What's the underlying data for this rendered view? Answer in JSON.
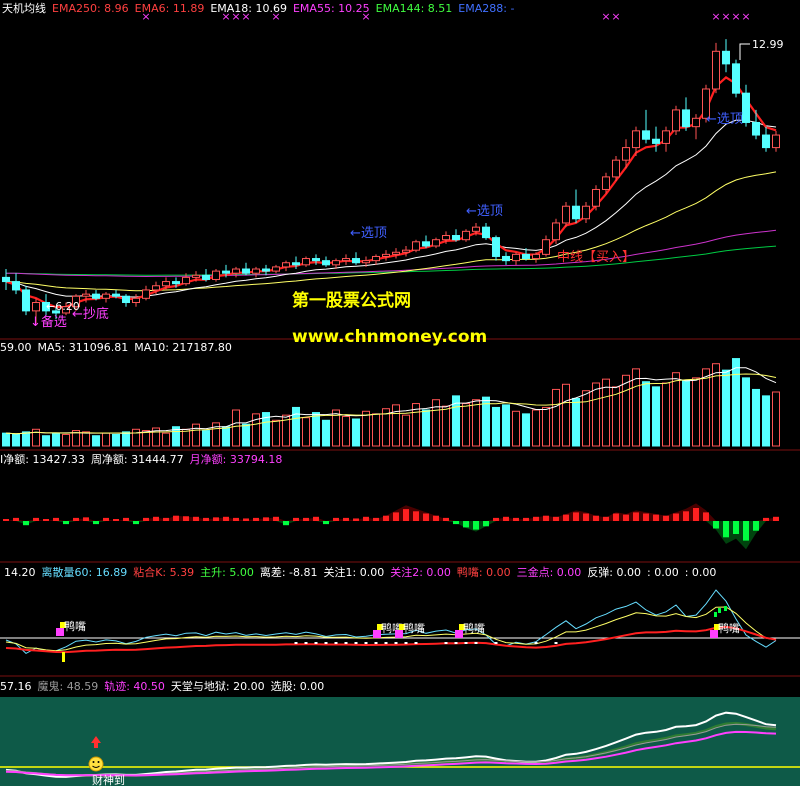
{
  "colors": {
    "up": "#ff5555",
    "down": "#55ffff",
    "divider": "#7a1010",
    "ema6": "#ff2020",
    "ema18": "#ffffff",
    "ema55": "#ffff66",
    "ema144": "#00cc44",
    "ema250": "#cc33cc",
    "ema288": "#3a6ad0",
    "magenta": "#ff40ff",
    "green": "#00ff40",
    "yellow": "#ffff00",
    "panel5bg": "#0e5a48",
    "panel5line": "#ffff00",
    "cyanline": "#66ddff"
  },
  "panel1": {
    "legend": [
      {
        "text": "天机均线",
        "color": "#ffffff"
      },
      {
        "text": "EMA250: 8.96",
        "color": "#ff4040"
      },
      {
        "text": "EMA6: 11.89",
        "color": "#ff4040"
      },
      {
        "text": "EMA18: 10.69",
        "color": "#ffffff"
      },
      {
        "text": "EMA55: 10.25",
        "color": "#ff40ff"
      },
      {
        "text": "EMA144: 8.51",
        "color": "#40ff40"
      },
      {
        "text": "EMA288: -",
        "color": "#4070ff"
      }
    ],
    "annotations": {
      "high": "12.99",
      "low": "←6.20",
      "select_top1": "←选顶",
      "select_top2": "←选顶",
      "select_top3": "←选顶",
      "middle_buy": "中线【买入】",
      "stock_line": "↓备选",
      "bottom_fish": "←抄底"
    },
    "markers": "×",
    "watermark": {
      "title": "第一股票公式网",
      "url": "www.chnmoney.com"
    }
  },
  "panel2": {
    "legend": [
      {
        "text": "59.00",
        "color": "#ffffff"
      },
      {
        "text": "MA5: 311096.81",
        "color": "#ffffff"
      },
      {
        "text": "MA10: 217187.80",
        "color": "#ffffff"
      }
    ]
  },
  "panel3": {
    "legend": [
      {
        "text": "I净额: 13427.33",
        "color": "#ffffff"
      },
      {
        "text": "周净额: 31444.77",
        "color": "#ffffff"
      },
      {
        "text": "月净额: 33794.18",
        "color": "#ff40ff"
      }
    ]
  },
  "panel4": {
    "legend": [
      {
        "text": "14.20",
        "color": "#ffffff"
      },
      {
        "text": "离散量60: 16.89",
        "color": "#66ddff"
      },
      {
        "text": "粘合K: 5.39",
        "color": "#ff4040"
      },
      {
        "text": "主升: 5.00",
        "color": "#40ff40"
      },
      {
        "text": "离差: -8.81",
        "color": "#ffffff"
      },
      {
        "text": "关注1: 0.00",
        "color": "#ffffff"
      },
      {
        "text": "关注2: 0.00",
        "color": "#ff40ff"
      },
      {
        "text": "鸭嘴: 0.00",
        "color": "#ff4040"
      },
      {
        "text": "三金点: 0.00",
        "color": "#ff40ff"
      },
      {
        "text": "反弹: 0.00",
        "color": "#ffffff"
      },
      {
        "text": ": 0.00",
        "color": "#ffffff"
      },
      {
        "text": ": 0.00",
        "color": "#ffffff"
      }
    ],
    "duckbill": "鸭嘴"
  },
  "panel5": {
    "legend": [
      {
        "text": "57.16",
        "color": "#ffffff"
      },
      {
        "text": "魔鬼: 48.59",
        "color": "#999999"
      },
      {
        "text": "轨迹: 40.50",
        "color": "#ff40ff"
      },
      {
        "text": "天堂与地狱: 20.00",
        "color": "#ffffff"
      },
      {
        "text": "选股: 0.00",
        "color": "#ffffff"
      }
    ],
    "fortune": "财神到"
  },
  "chart_data": {
    "type": "candlestick",
    "price_range": [
      5.9,
      13.4
    ],
    "candles": [
      [
        7.3,
        7.5,
        7.0,
        7.2
      ],
      [
        7.2,
        7.4,
        6.9,
        7.0
      ],
      [
        7.0,
        7.1,
        6.4,
        6.5
      ],
      [
        6.5,
        6.8,
        6.2,
        6.7
      ],
      [
        6.7,
        6.9,
        6.4,
        6.5
      ],
      [
        6.5,
        6.6,
        6.3,
        6.45
      ],
      [
        6.45,
        6.7,
        6.4,
        6.6
      ],
      [
        6.6,
        6.9,
        6.5,
        6.85
      ],
      [
        6.85,
        7.0,
        6.7,
        6.9
      ],
      [
        6.9,
        7.0,
        6.75,
        6.8
      ],
      [
        6.8,
        6.95,
        6.7,
        6.9
      ],
      [
        6.9,
        7.0,
        6.8,
        6.85
      ],
      [
        6.85,
        6.9,
        6.6,
        6.7
      ],
      [
        6.7,
        6.9,
        6.6,
        6.8
      ],
      [
        6.8,
        7.1,
        6.75,
        7.0
      ],
      [
        7.0,
        7.2,
        6.9,
        7.1
      ],
      [
        7.1,
        7.3,
        7.0,
        7.2
      ],
      [
        7.2,
        7.3,
        7.05,
        7.15
      ],
      [
        7.15,
        7.4,
        7.1,
        7.3
      ],
      [
        7.3,
        7.45,
        7.2,
        7.35
      ],
      [
        7.35,
        7.5,
        7.2,
        7.25
      ],
      [
        7.25,
        7.5,
        7.2,
        7.45
      ],
      [
        7.45,
        7.6,
        7.3,
        7.4
      ],
      [
        7.4,
        7.55,
        7.3,
        7.5
      ],
      [
        7.5,
        7.65,
        7.35,
        7.4
      ],
      [
        7.4,
        7.55,
        7.3,
        7.5
      ],
      [
        7.5,
        7.6,
        7.35,
        7.45
      ],
      [
        7.45,
        7.6,
        7.4,
        7.55
      ],
      [
        7.55,
        7.7,
        7.45,
        7.65
      ],
      [
        7.65,
        7.8,
        7.5,
        7.6
      ],
      [
        7.6,
        7.8,
        7.55,
        7.75
      ],
      [
        7.75,
        7.85,
        7.6,
        7.7
      ],
      [
        7.7,
        7.8,
        7.55,
        7.6
      ],
      [
        7.6,
        7.75,
        7.5,
        7.7
      ],
      [
        7.7,
        7.85,
        7.6,
        7.75
      ],
      [
        7.75,
        7.9,
        7.6,
        7.65
      ],
      [
        7.65,
        7.8,
        7.55,
        7.7
      ],
      [
        7.7,
        7.85,
        7.6,
        7.8
      ],
      [
        7.8,
        7.95,
        7.7,
        7.85
      ],
      [
        7.85,
        8.0,
        7.75,
        7.9
      ],
      [
        7.9,
        8.05,
        7.8,
        7.95
      ],
      [
        7.95,
        8.2,
        7.9,
        8.15
      ],
      [
        8.15,
        8.3,
        8.0,
        8.05
      ],
      [
        8.05,
        8.25,
        8.0,
        8.2
      ],
      [
        8.2,
        8.4,
        8.1,
        8.3
      ],
      [
        8.3,
        8.45,
        8.15,
        8.2
      ],
      [
        8.2,
        8.45,
        8.15,
        8.4
      ],
      [
        8.4,
        8.6,
        8.3,
        8.5
      ],
      [
        8.5,
        8.6,
        8.2,
        8.25
      ],
      [
        8.25,
        8.3,
        7.7,
        7.8
      ],
      [
        7.8,
        7.9,
        7.6,
        7.7
      ],
      [
        7.7,
        7.9,
        7.6,
        7.85
      ],
      [
        7.85,
        8.0,
        7.7,
        7.75
      ],
      [
        7.75,
        7.9,
        7.65,
        7.85
      ],
      [
        7.85,
        8.3,
        7.8,
        8.2
      ],
      [
        8.2,
        8.7,
        8.1,
        8.6
      ],
      [
        8.6,
        9.1,
        8.5,
        9.0
      ],
      [
        9.0,
        9.4,
        8.6,
        8.7
      ],
      [
        8.7,
        9.1,
        8.6,
        9.0
      ],
      [
        9.0,
        9.5,
        8.9,
        9.4
      ],
      [
        9.4,
        9.8,
        9.3,
        9.7
      ],
      [
        9.7,
        10.2,
        9.6,
        10.1
      ],
      [
        10.1,
        10.6,
        9.9,
        10.4
      ],
      [
        10.4,
        10.9,
        10.2,
        10.8
      ],
      [
        10.8,
        11.3,
        10.5,
        10.6
      ],
      [
        10.6,
        10.9,
        10.3,
        10.5
      ],
      [
        10.5,
        10.9,
        10.3,
        10.8
      ],
      [
        10.8,
        11.4,
        10.7,
        11.3
      ],
      [
        11.3,
        11.6,
        10.8,
        10.9
      ],
      [
        10.9,
        11.2,
        10.6,
        11.1
      ],
      [
        11.1,
        11.9,
        11.0,
        11.8
      ],
      [
        11.8,
        12.9,
        11.7,
        12.7
      ],
      [
        12.7,
        12.99,
        12.2,
        12.4
      ],
      [
        12.4,
        12.5,
        11.6,
        11.7
      ],
      [
        11.7,
        11.9,
        10.9,
        11.0
      ],
      [
        11.0,
        11.3,
        10.6,
        10.7
      ],
      [
        10.7,
        10.9,
        10.3,
        10.4
      ],
      [
        10.4,
        10.8,
        10.3,
        10.7
      ]
    ],
    "series": [
      {
        "name": "EMA6",
        "last": 11.89
      },
      {
        "name": "EMA18",
        "last": 10.69
      },
      {
        "name": "EMA55",
        "last": 10.25
      },
      {
        "name": "EMA144",
        "last": 8.51
      },
      {
        "name": "EMA250",
        "last": 8.96
      }
    ],
    "volume": [
      1.0,
      0.9,
      1.1,
      1.3,
      0.8,
      1.0,
      0.9,
      1.2,
      1.1,
      0.8,
      1.0,
      0.9,
      1.1,
      1.3,
      1.2,
      1.4,
      1.0,
      1.5,
      1.3,
      1.7,
      1.2,
      1.8,
      1.5,
      2.8,
      1.7,
      2.5,
      2.6,
      2.0,
      2.4,
      3.0,
      2.2,
      2.6,
      2.0,
      2.8,
      2.3,
      2.1,
      2.7,
      2.5,
      2.9,
      3.2,
      2.4,
      3.3,
      2.8,
      3.6,
      3.1,
      3.9,
      3.3,
      3.6,
      3.8,
      3.0,
      3.2,
      2.7,
      2.5,
      2.8,
      3.0,
      4.4,
      4.8,
      3.7,
      4.3,
      4.9,
      5.2,
      4.6,
      5.5,
      6.0,
      5.0,
      4.6,
      4.9,
      5.7,
      5.1,
      5.3,
      6.0,
      6.4,
      5.9,
      6.8,
      5.3,
      4.4,
      3.9,
      4.2
    ],
    "volume_ma": [
      "MA5: 311096.81",
      "MA10: 217187.80"
    ],
    "net_flow": [
      0,
      0.1,
      -0.2,
      0.1,
      0,
      0.1,
      -0.1,
      0.1,
      0.15,
      -0.1,
      0.1,
      0,
      0.1,
      -0.1,
      0.1,
      0.2,
      0.1,
      0.3,
      0.25,
      0.2,
      0.1,
      0.15,
      0.2,
      0.1,
      0.05,
      0.1,
      0.15,
      0.2,
      -0.2,
      0.1,
      0.1,
      0.2,
      -0.1,
      0.1,
      0.1,
      0.05,
      0.2,
      0.1,
      0.3,
      0.6,
      0.9,
      0.7,
      0.5,
      0.3,
      0.1,
      -0.1,
      -0.4,
      -0.6,
      -0.3,
      0.1,
      0.2,
      0.1,
      0.1,
      0.2,
      0.3,
      0.2,
      0.4,
      0.6,
      0.5,
      0.3,
      0.2,
      0.5,
      0.4,
      0.6,
      0.5,
      0.4,
      0.3,
      0.5,
      0.7,
      1.0,
      0.6,
      -0.5,
      -1.3,
      -1.0,
      -1.6,
      -0.7,
      0.1,
      0.2
    ]
  }
}
